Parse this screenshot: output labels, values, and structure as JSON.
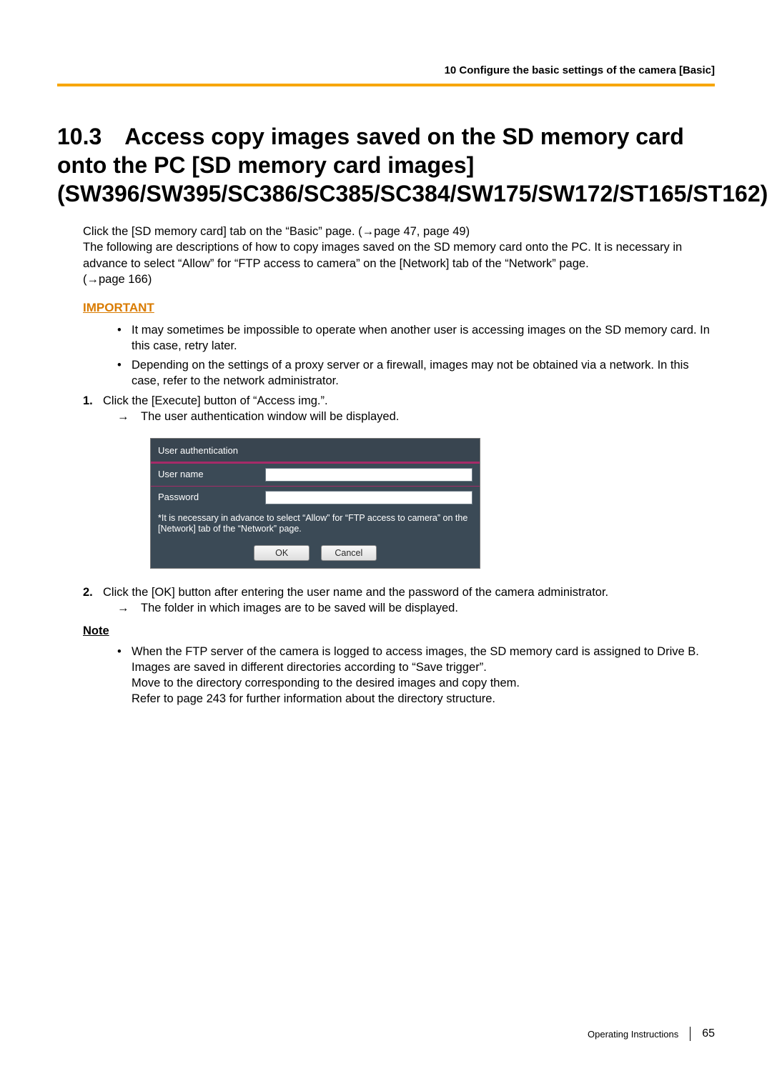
{
  "header": {
    "running": "10 Configure the basic settings of the camera [Basic]"
  },
  "title": "10.3 Access copy images saved on the SD memory card onto the PC [SD memory card images] (SW396/SW395/SC386/SC385/SC384/SW175/SW172/ST165/ST162)",
  "intro": {
    "p1a": "Click the [SD memory card] tab on the “Basic” page. (",
    "p1b": "page 47, page 49)",
    "p2": "The following are descriptions of how to copy images saved on the SD memory card onto the PC. It is necessary in advance to select “Allow” for “FTP access to camera” on the [Network] tab of the “Network” page.",
    "p3a": "(",
    "p3b": "page 166)"
  },
  "important": {
    "label": "IMPORTANT",
    "items": [
      "It may sometimes be impossible to operate when another user is accessing images on the SD memory card. In this case, retry later.",
      "Depending on the settings of a proxy server or a firewall, images may not be obtained via a network. In this case, refer to the network administrator."
    ]
  },
  "steps": {
    "s1_num": "1.",
    "s1_text": "Click the [Execute] button of “Access img.”.",
    "s1_result": "→ The user authentication window will be displayed.",
    "s2_num": "2.",
    "s2_text": "Click the [OK] button after entering the user name and the password of the camera administrator.",
    "s2_result": "→ The folder in which images are to be saved will be displayed."
  },
  "dialog": {
    "title": "User authentication",
    "user_label": "User name",
    "pass_label": "Password",
    "note": "*It is necessary in advance to select “Allow” for “FTP access to camera” on the [Network] tab of the “Network” page.",
    "ok": "OK",
    "cancel": "Cancel"
  },
  "note": {
    "label": "Note",
    "item1_l1": "When the FTP server of the camera is logged to access images, the SD memory card is assigned to Drive B.",
    "item1_l2": "Images are saved in different directories according to “Save trigger”.",
    "item1_l3": "Move to the directory corresponding to the desired images and copy them.",
    "item1_l4": "Refer to page 243 for further information about the directory structure."
  },
  "footer": {
    "doc": "Operating Instructions",
    "page": "65"
  }
}
